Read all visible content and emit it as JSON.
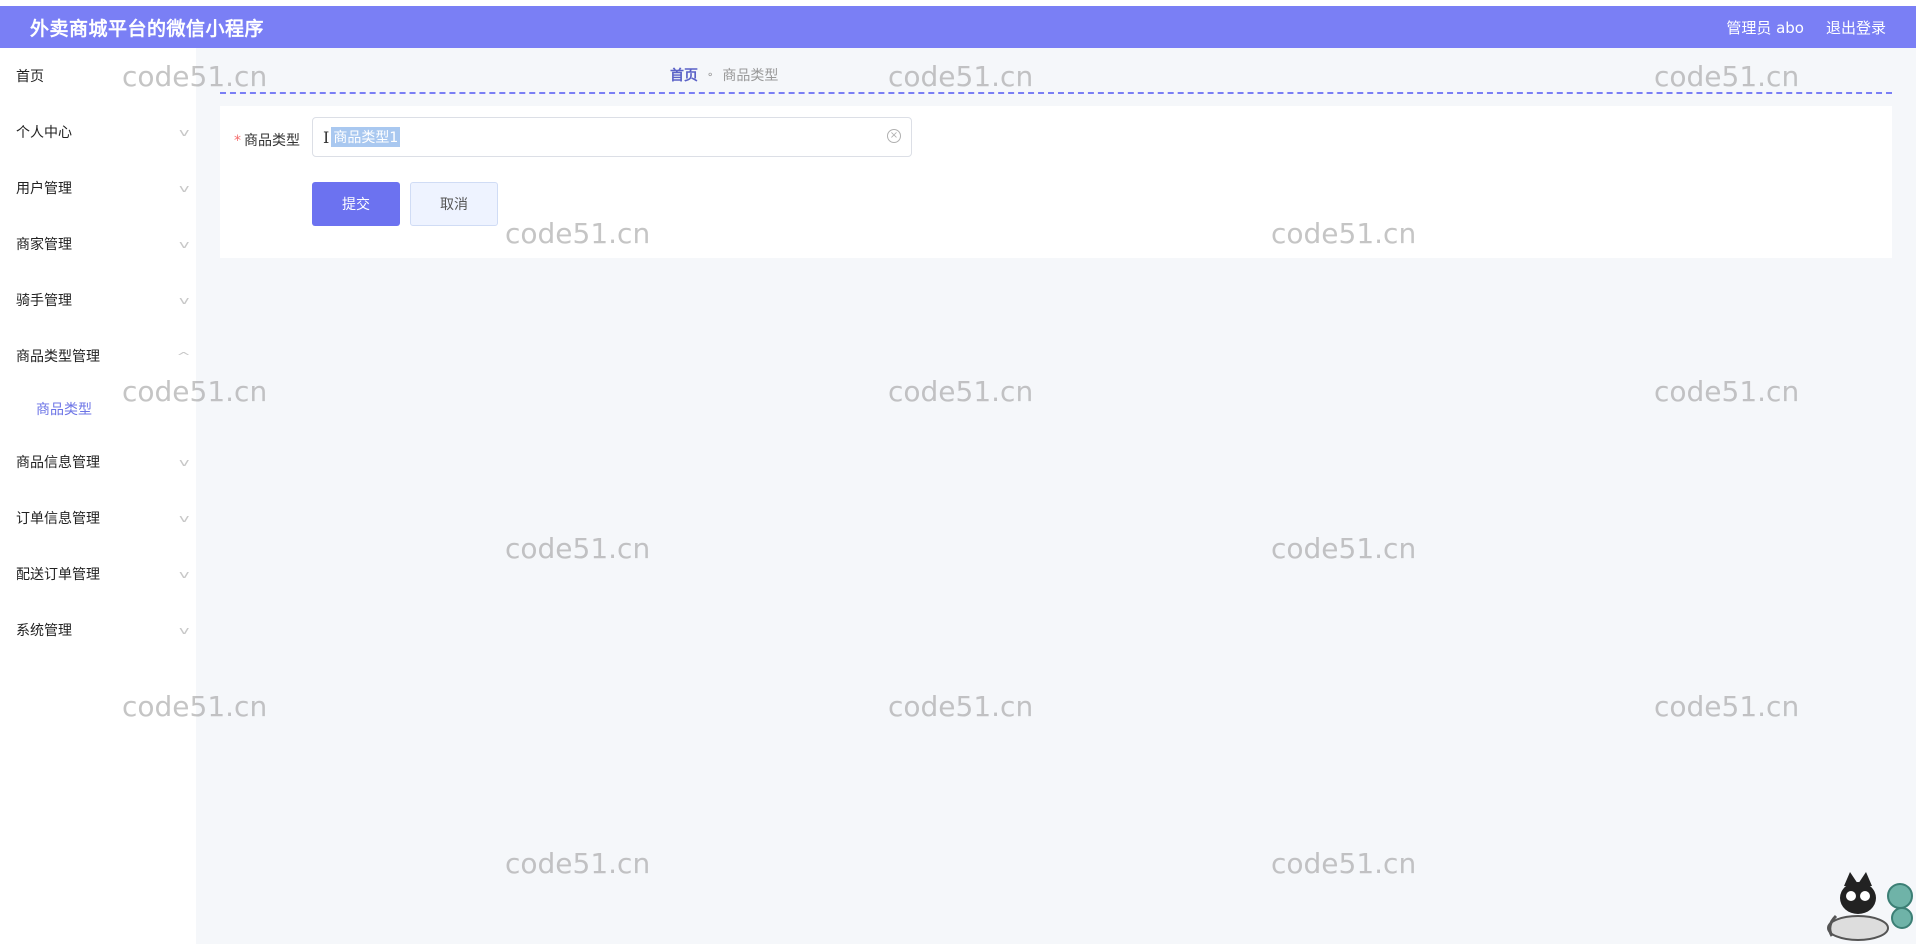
{
  "header": {
    "title": "外卖商城平台的微信小程序",
    "user": "管理员 abo",
    "logout": "退出登录"
  },
  "sidebar": {
    "items": [
      {
        "label": "首页"
      },
      {
        "label": "个人中心"
      },
      {
        "label": "用户管理"
      },
      {
        "label": "商家管理"
      },
      {
        "label": "骑手管理"
      },
      {
        "label": "商品类型管理",
        "sub": "商品类型"
      },
      {
        "label": "商品信息管理"
      },
      {
        "label": "订单信息管理"
      },
      {
        "label": "配送订单管理"
      },
      {
        "label": "系统管理"
      }
    ]
  },
  "breadcrumb": {
    "home": "首页",
    "separator": "⚬",
    "current": "商品类型"
  },
  "form": {
    "label": "商品类型",
    "required_mark": "*",
    "value": "商品类型1",
    "submit": "提交",
    "cancel": "取消"
  },
  "watermark": "code51.cn",
  "colors": {
    "accent": "#7a7ff5",
    "button": "#6c72f0",
    "active_menu": "#6c74e6"
  }
}
